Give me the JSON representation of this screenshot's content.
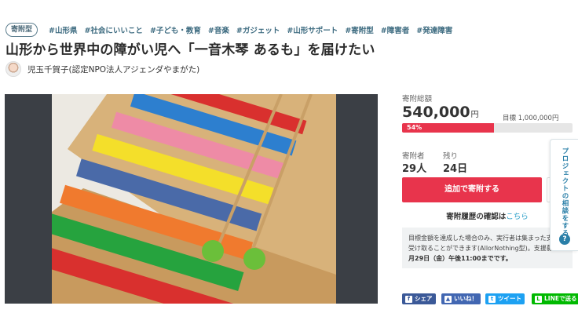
{
  "header": {
    "type_badge": "寄附型",
    "tags": [
      "#山形県",
      "#社会にいいこと",
      "#子ども・教育",
      "#音楽",
      "#ガジェット",
      "#山形サポート",
      "#寄附型",
      "#障害者",
      "#発達障害"
    ],
    "title": "山形から世界中の障がい児へ「一音木琴 あるも」を届けたい",
    "owner": "児玉千賀子(認定NPO法人アジェンダやまがた)"
  },
  "stats": {
    "total_label": "寄附総額",
    "total_amount": "540,000",
    "total_unit": "円",
    "goal_text": "目標 1,000,000円",
    "progress_pct": 54,
    "progress_label": "54%",
    "donors_label": "寄附者",
    "donors_value": "29人",
    "remaining_label": "残り",
    "remaining_value": "24日"
  },
  "actions": {
    "donate_label": "追加で寄附する",
    "history_text": "寄附履歴の確認は",
    "history_link": "こちら"
  },
  "notice": {
    "line1": "目標金額を達成した場合のみ、実行者は集まった支",
    "line2": "受け取ることができます(AllorNothing型)。支援募集",
    "line3": "月29日（金）午後11:00までです。"
  },
  "side_tab": {
    "label": "プロジェクトの相談をする",
    "help": "?"
  },
  "share": {
    "facebook": "シェア",
    "like": "いいね！",
    "twitter": "ツイート",
    "line": "LINEで送る"
  },
  "colors": {
    "accent": "#e8344c",
    "tag": "#3d6b80",
    "link": "#2a9fc8",
    "facebook": "#3b5998",
    "twitter": "#1da1f2",
    "line": "#00b900"
  }
}
